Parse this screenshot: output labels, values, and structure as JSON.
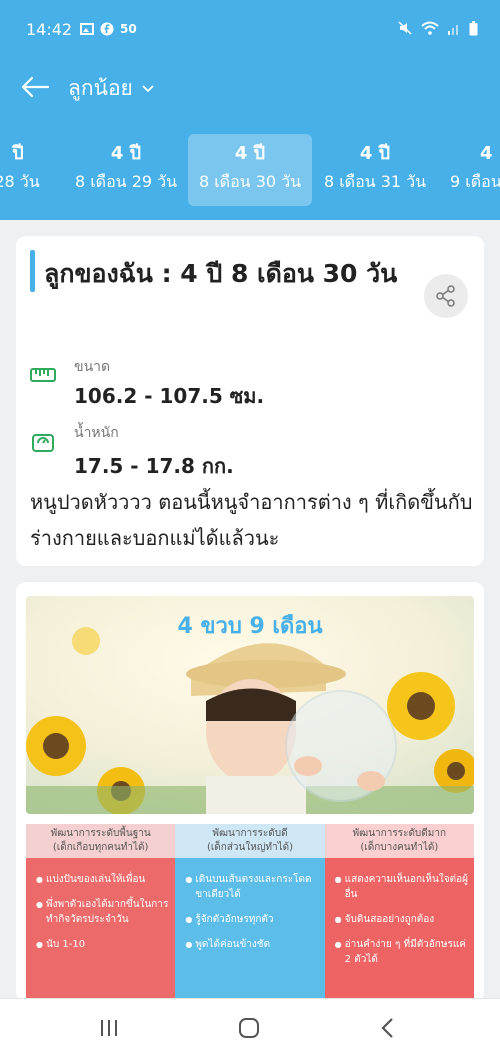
{
  "status": {
    "time": "14:42",
    "badge": "50"
  },
  "appbar": {
    "title": "ลูกน้อย"
  },
  "tabs": [
    {
      "l1": "ปี",
      "l2": "28 วัน"
    },
    {
      "l1": "4 ปี",
      "l2": "8 เดือน 29 วัน"
    },
    {
      "l1": "4 ปี",
      "l2": "8 เดือน 30 วัน"
    },
    {
      "l1": "4 ปี",
      "l2": "8 เดือน 31 วัน"
    },
    {
      "l1": "4",
      "l2": "9 เดือน"
    }
  ],
  "card": {
    "heading": "ลูกของฉัน : 4  ปี 8 เดือน 30 วัน",
    "size_label": "ขนาด",
    "size_value": "106.2 - 107.5 ซม.",
    "weight_label": "น้ำหนัก",
    "weight_value": "17.5 - 17.8 กก.",
    "note": "หนูปวดหัวววว ตอนนี้หนูจำอาการต่าง ๆ ที่เกิดขึ้นกับร่างกายและบอกแม่ได้แล้วนะ"
  },
  "infographic": {
    "title": "4 ขวบ 9 เดือน",
    "columns": [
      {
        "head1": "พัฒนาการระดับพื้นฐาน",
        "head2": "(เด็กเกือบทุกคนทำได้)",
        "items": [
          "แบ่งปันของเล่นให้เพื่อน",
          "พึ่งพาตัวเองได้มากขึ้นในการทำกิจวัตรประจำวัน",
          "นับ 1-10"
        ]
      },
      {
        "head1": "พัฒนาการระดับดี",
        "head2": "(เด็กส่วนใหญ่ทำได้)",
        "items": [
          "เดินบนเส้นตรงและกระโดดขาเดียวได้",
          "รู้จักตัวอักษรทุกตัว",
          "พูดได้ค่อนข้างชัด"
        ]
      },
      {
        "head1": "พัฒนาการระดับดีมาก",
        "head2": "(เด็กบางคนทำได้)",
        "items": [
          "แสดงความเห็นอกเห็นใจต่อผู้อื่น",
          "จับดินสออย่างถูกต้อง",
          "อ่านคำง่าย ๆ ที่มีตัวอักษรแค่ 2 ตัวได้"
        ]
      }
    ]
  },
  "colors": {
    "primary": "#47b0e8",
    "red": "#ec6a6a",
    "blue": "#5cbde8"
  }
}
